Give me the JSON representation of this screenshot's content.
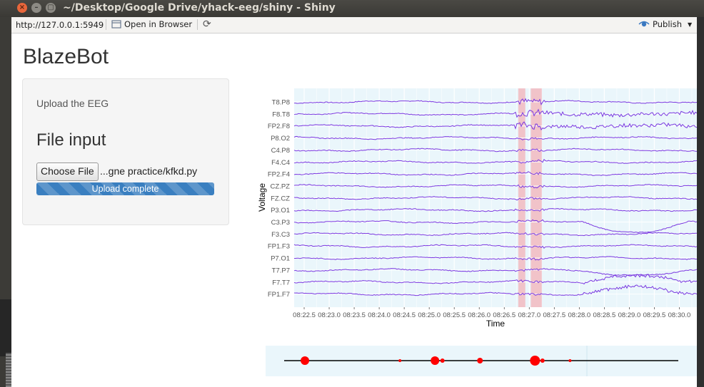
{
  "window": {
    "title": "~/Desktop/Google Drive/yhack-eeg/shiny - Shiny"
  },
  "toolbar": {
    "url": "http://127.0.0.1:5949",
    "open_browser": "Open in Browser",
    "publish": "Publish"
  },
  "app": {
    "title": "BlazeBot",
    "upload_label": "Upload the EEG",
    "file_input_heading": "File input",
    "choose_file": "Choose File",
    "file_name": "...gne practice/kfkd.py",
    "progress_text": "Upload complete",
    "progress_fraction": 1.0
  },
  "chart_data": [
    {
      "type": "line",
      "xlabel": "Time",
      "ylabel": "Voltage",
      "x_ticks": [
        "08:22.5",
        "08:23.0",
        "08:23.5",
        "08:24.0",
        "08:24.5",
        "08:25.0",
        "08:25.5",
        "08:26.0",
        "08:26.5",
        "08:27.0",
        "08:27.5",
        "08:28.0",
        "08:28.5",
        "08:29.0",
        "08:29.5",
        "08:30.0"
      ],
      "channels": [
        "T8.P8",
        "F8.T8",
        "FP2.F8",
        "P8.O2",
        "C4.P8",
        "F4.C4",
        "FP2.F4",
        "CZ.PZ",
        "FZ.CZ",
        "P3.O1",
        "C3.P3",
        "F3.C3",
        "FP1.F3",
        "P7.O1",
        "T7.P7",
        "F7.T7",
        "FP1.F7"
      ],
      "highlight_regions": [
        [
          "08:26.78",
          "08:26.92"
        ],
        [
          "08:27.03",
          "08:27.25"
        ]
      ],
      "colors": {
        "line": "#7a38e0",
        "background": "#eaf6fb",
        "grid": "#ffffff",
        "highlight": "#f1c3c9"
      },
      "legend": "none"
    },
    {
      "type": "scatter",
      "description": "event timeline",
      "colors": {
        "point": "#ff0000",
        "line": "#000000",
        "background": "#eaf6fb"
      },
      "points": [
        {
          "t": "08:22.7",
          "size": 5
        },
        {
          "t": "08:24.6",
          "size": 1
        },
        {
          "t": "08:25.3",
          "size": 5
        },
        {
          "t": "08:25.45",
          "size": 2
        },
        {
          "t": "08:26.2",
          "size": 3
        },
        {
          "t": "08:27.3",
          "size": 6
        },
        {
          "t": "08:27.45",
          "size": 2
        },
        {
          "t": "08:28.0",
          "size": 1
        }
      ]
    }
  ]
}
